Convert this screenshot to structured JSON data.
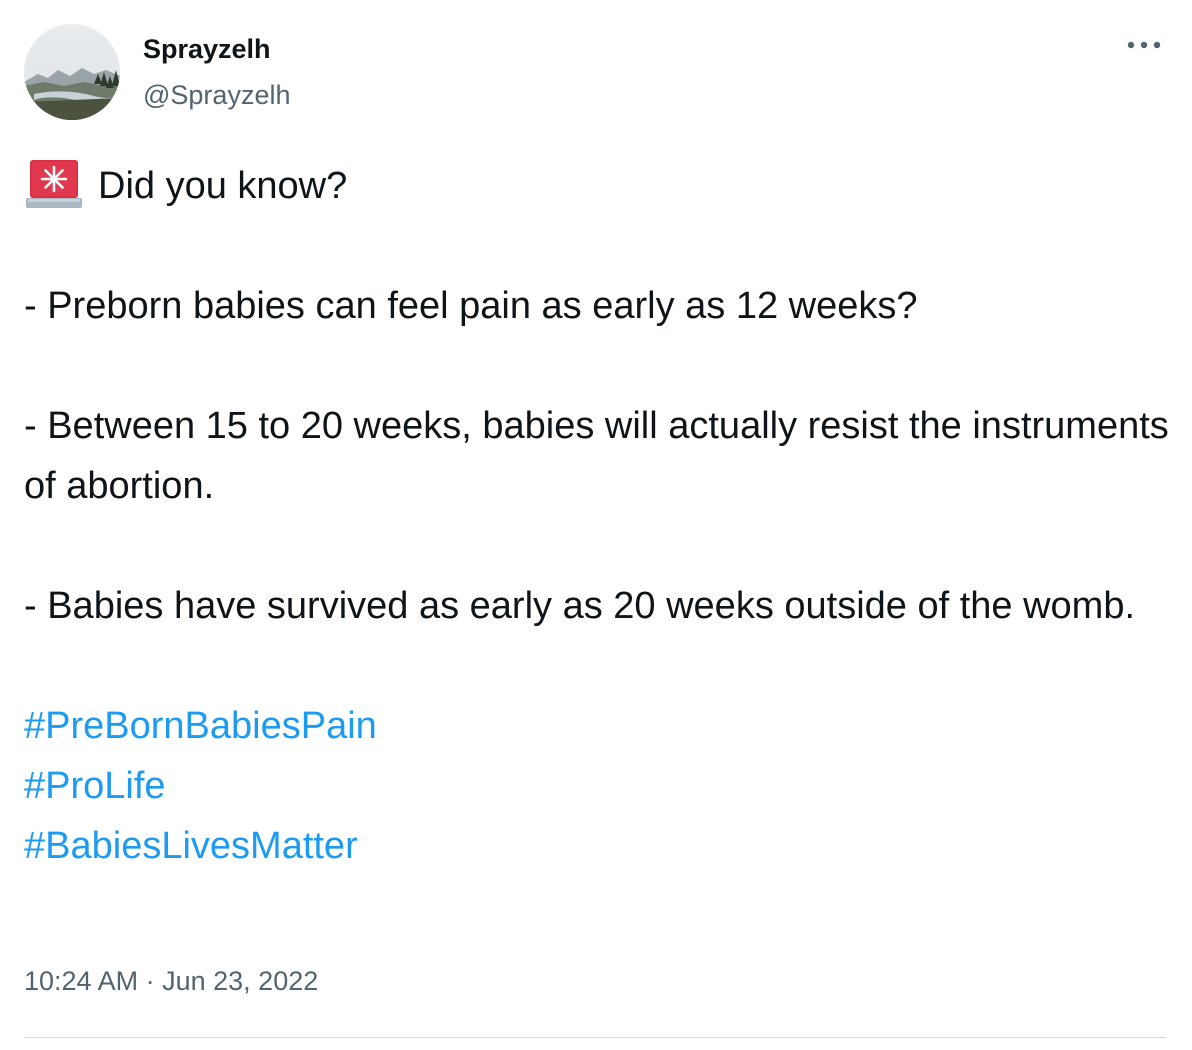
{
  "author": {
    "display_name": "Sprayzelh",
    "handle": "@Sprayzelh",
    "avatar_icon": "landscape-avatar-icon"
  },
  "menu": {
    "more_icon": "more-horizontal-icon"
  },
  "tweet": {
    "emoji_icon": "police-siren-icon",
    "line1": "Did you know?",
    "para1": "- Preborn babies can feel pain as early as 12 weeks?",
    "para2": "- Between 15 to 20 weeks, babies will actually resist the instruments of abortion.",
    "para3": "- Babies have survived as early as 20 weeks outside of the womb.",
    "hashtags": [
      "#PreBornBabiesPain",
      "#ProLife",
      "#BabiesLivesMatter"
    ],
    "hashtag_color": "#1d9bf0"
  },
  "meta": {
    "time": "10:24 AM",
    "separator": "·",
    "date": "Jun 23, 2022"
  }
}
